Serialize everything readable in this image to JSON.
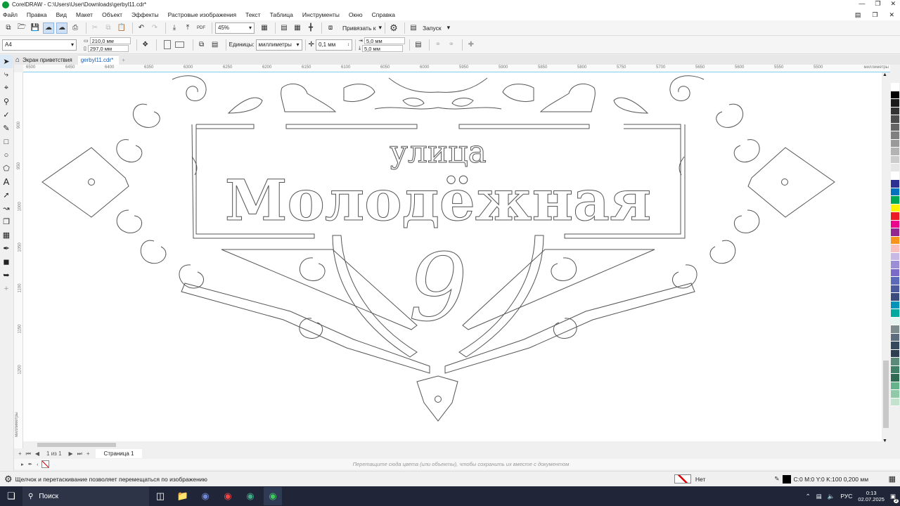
{
  "window": {
    "title": "CorelDRAW - C:\\Users\\User\\Downloads\\gerbyl11.cdr*"
  },
  "menu": [
    "Файл",
    "Правка",
    "Вид",
    "Макет",
    "Объект",
    "Эффекты",
    "Растровые изображения",
    "Текст",
    "Таблица",
    "Инструменты",
    "Окно",
    "Справка"
  ],
  "toolbar1": {
    "zoom": "45%",
    "snap_label": "Привязать к",
    "launch_label": "Запуск",
    "pdf_label": "PDF"
  },
  "toolbar2": {
    "page_size": "A4",
    "width": "210,0 мм",
    "height": "297,0 мм",
    "units_label": "Единицы:",
    "units": "миллиметры",
    "nudge": "0,1 мм",
    "dup_x": "5,0 мм",
    "dup_y": "5,0 мм"
  },
  "tabs": [
    {
      "label": "Экран приветствия"
    },
    {
      "label": "gerbyl11.cdr*"
    }
  ],
  "ruler": {
    "h_ticks": [
      "6500",
      "6450",
      "6400",
      "6350",
      "6300",
      "6250",
      "6200",
      "6150",
      "6100",
      "6050",
      "6000",
      "5950",
      "5900",
      "5850",
      "5800",
      "5750",
      "5700",
      "5650",
      "5600",
      "5550",
      "5500"
    ],
    "h_unit": "миллиметры",
    "v_ticks": [
      "900",
      "950",
      "1000",
      "1050",
      "1100",
      "1150",
      "1200"
    ],
    "v_unit": "миллиметры"
  },
  "artwork": {
    "line1": "улица",
    "line2": "Молодёжная",
    "number": "9"
  },
  "pagebar": {
    "page_counter": "1 из 1",
    "page_tab": "Страница 1"
  },
  "docpalette_hint": "Перетащите сюда цвета (или объекты), чтобы сохранить их вместе с документом",
  "status": {
    "hint": "Щелчок и перетаскивание позволяет перемещаться по изображению",
    "fill_label": "Нет",
    "outline": "C:0 M:0 Y:0 K:100  0,200 мм"
  },
  "taskbar": {
    "search_label": "Поиск",
    "lang": "РУС",
    "time": "0:13",
    "date": "02.07.2025",
    "notif_count": "3"
  },
  "palette_colors": [
    "#ffffff",
    "#000000",
    "#1a1a1a",
    "#333333",
    "#4d4d4d",
    "#666666",
    "#808080",
    "#999999",
    "#b3b3b3",
    "#cccccc",
    "#e6e6e6",
    "#ffffff",
    "#2e3192",
    "#0071bc",
    "#00a651",
    "#fff200",
    "#ed1c24",
    "#ec008c",
    "#92278f",
    "#f7941d",
    "#f9c0c0",
    "#c7b8e6",
    "#9b8ed6",
    "#7a6bc8",
    "#5b6ab8",
    "#4a5a9c",
    "#3a4a7c",
    "#0093b8",
    "#00a99d",
    "#e6f5f0",
    "#7f8c8d",
    "#5d6d7e",
    "#34495e",
    "#2c3e50",
    "#5c8a7a",
    "#3f7f68",
    "#2e6b52",
    "#66b28a",
    "#90c9a8",
    "#c4e3cf"
  ]
}
